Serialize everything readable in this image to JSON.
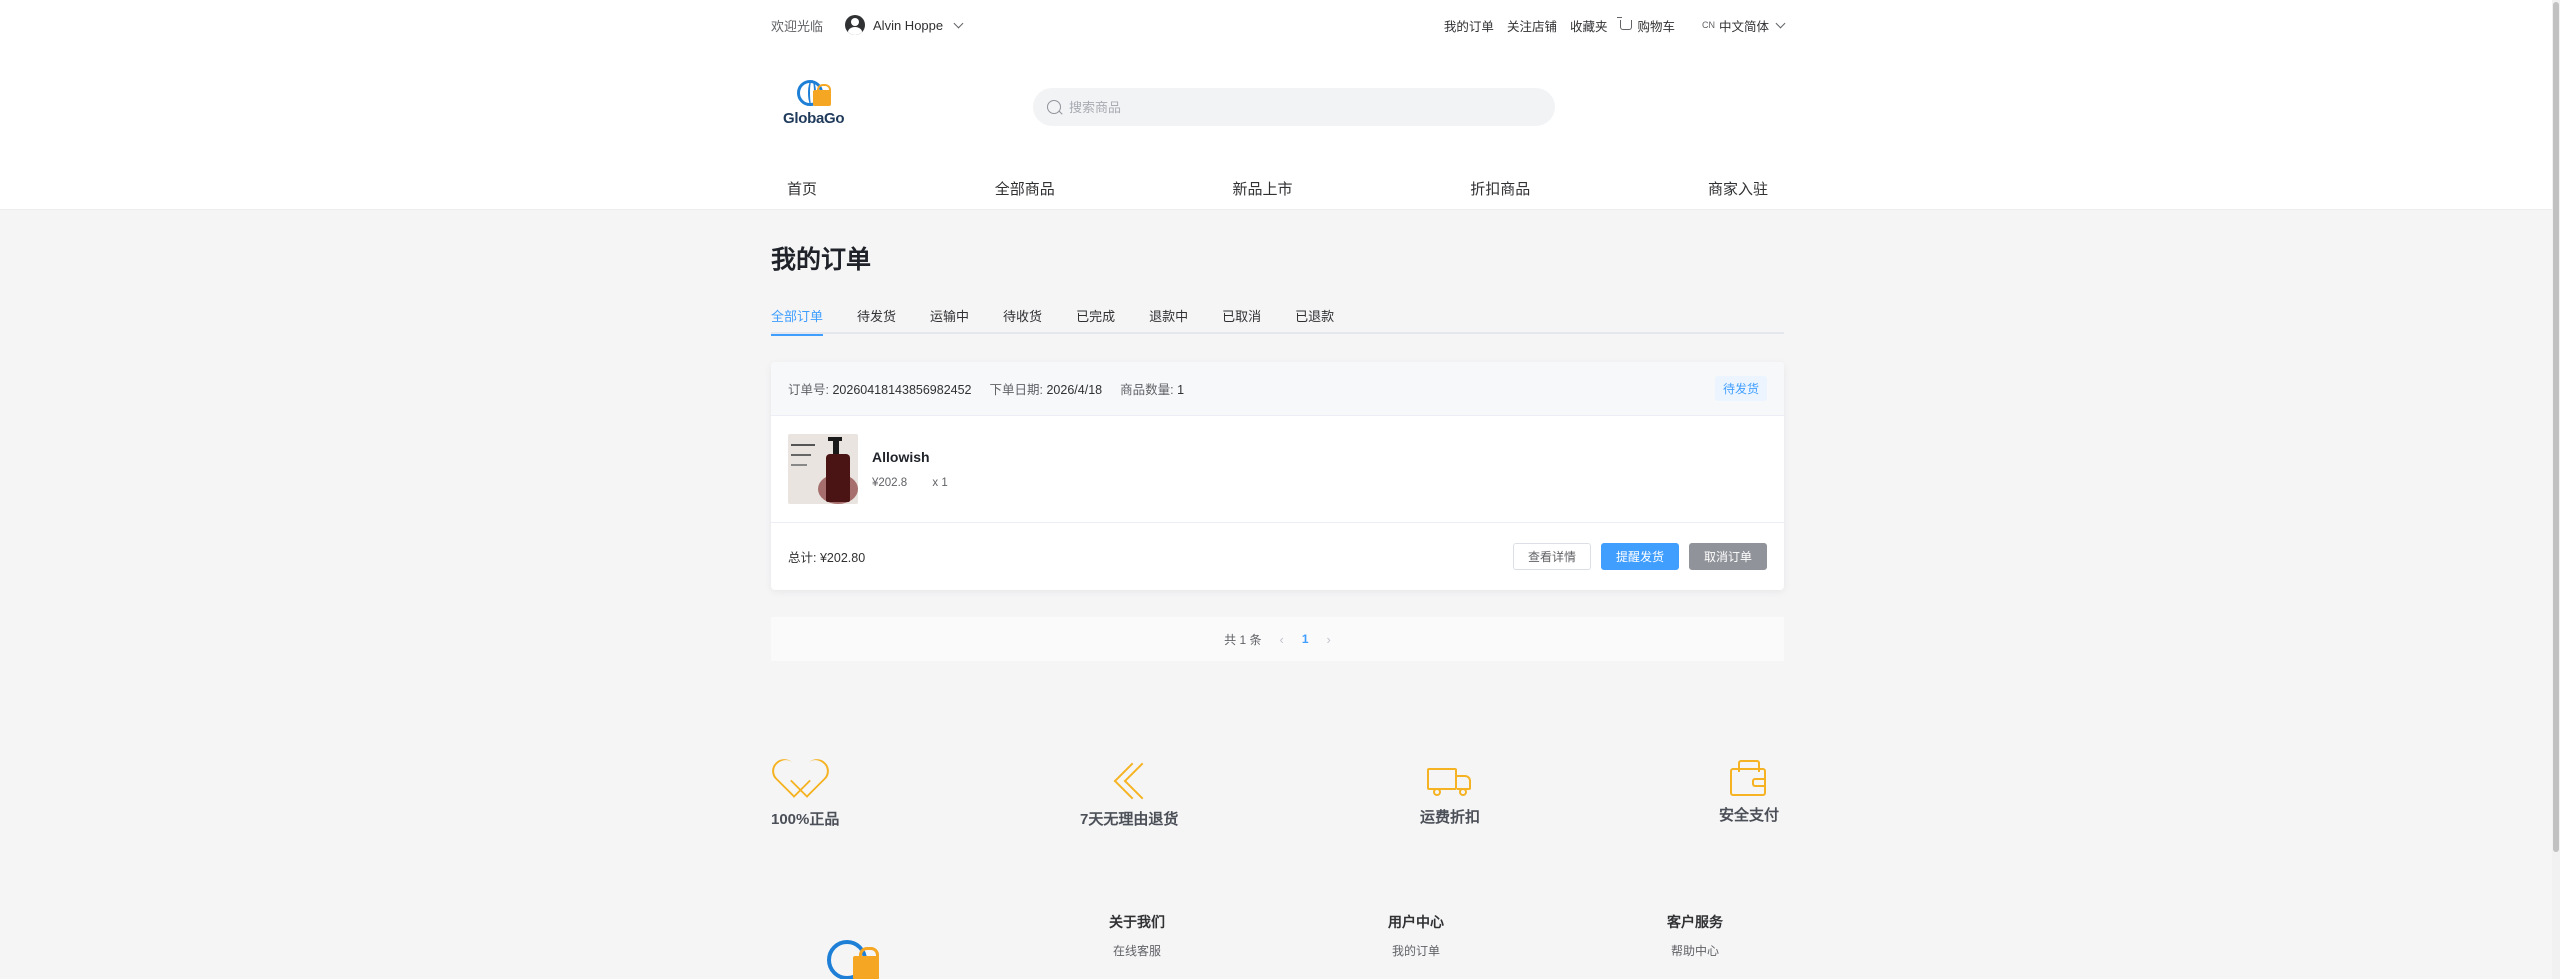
{
  "topbar": {
    "welcome": "欢迎光临",
    "user_name": "Alvin Hoppe",
    "links": [
      "我的订单",
      "关注店铺",
      "收藏夹"
    ],
    "cart_label": "购物车",
    "lang_code": "CN",
    "lang_label": "中文简体"
  },
  "header": {
    "brand": "GlobaGo",
    "search_placeholder": "搜索商品"
  },
  "nav": [
    "首页",
    "全部商品",
    "新品上市",
    "折扣商品",
    "商家入驻"
  ],
  "page_title": "我的订单",
  "tabs": [
    "全部订单",
    "待发货",
    "运输中",
    "待收货",
    "已完成",
    "退款中",
    "已取消",
    "已退款"
  ],
  "order": {
    "order_no_label": "订单号:",
    "order_no": "20260418143856982452",
    "date_label": "下单日期:",
    "date": "2026/4/18",
    "qty_label": "商品数量:",
    "qty": "1",
    "status": "待发货",
    "product_name": "Allowish",
    "product_price": "¥202.8",
    "product_qty": "x 1",
    "total_label": "总计:",
    "total": "¥202.80",
    "btn_detail": "查看详情",
    "btn_remind": "提醒发货",
    "btn_cancel": "取消订单"
  },
  "pager": {
    "total_text": "共 1 条",
    "current_page": "1",
    "prev": "‹",
    "next": "›"
  },
  "features": [
    "100%正品",
    "7天无理由退货",
    "运费折扣",
    "安全支付"
  ],
  "footer": {
    "cols": [
      {
        "heading": "关于我们",
        "link": "在线客服"
      },
      {
        "heading": "用户中心",
        "link": "我的订单"
      },
      {
        "heading": "客户服务",
        "link": "帮助中心"
      }
    ]
  },
  "colors": {
    "accent": "#409eff",
    "feature_icon": "#f5b323",
    "brand_blue": "#1e7fd6",
    "brand_orange": "#f5a623"
  }
}
